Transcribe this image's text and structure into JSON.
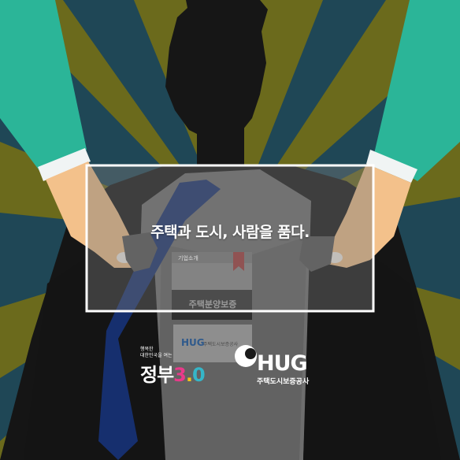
{
  "headline": "주택과 도시, 사람을 품다.",
  "card_tag": "기업소개",
  "card_title": "주택분양보증",
  "card_logo_text": "HUG",
  "card_logo_sub": "주택도시보증공사",
  "government": {
    "line1": "행복한",
    "line2": "대한민국을 여는",
    "word": "정부",
    "num3": "3",
    "dot": ".",
    "num0": "0"
  },
  "hug": {
    "word": "HUG",
    "sub": "주택도시보증공사"
  },
  "colors": {
    "sleeve": "#2ab59a",
    "skin": "#f4c08a",
    "tie": "#1a3a8a",
    "suit": "#1b1b1b",
    "ray_olive": "#6a6a1a",
    "ray_teal": "#1e4a5a"
  }
}
